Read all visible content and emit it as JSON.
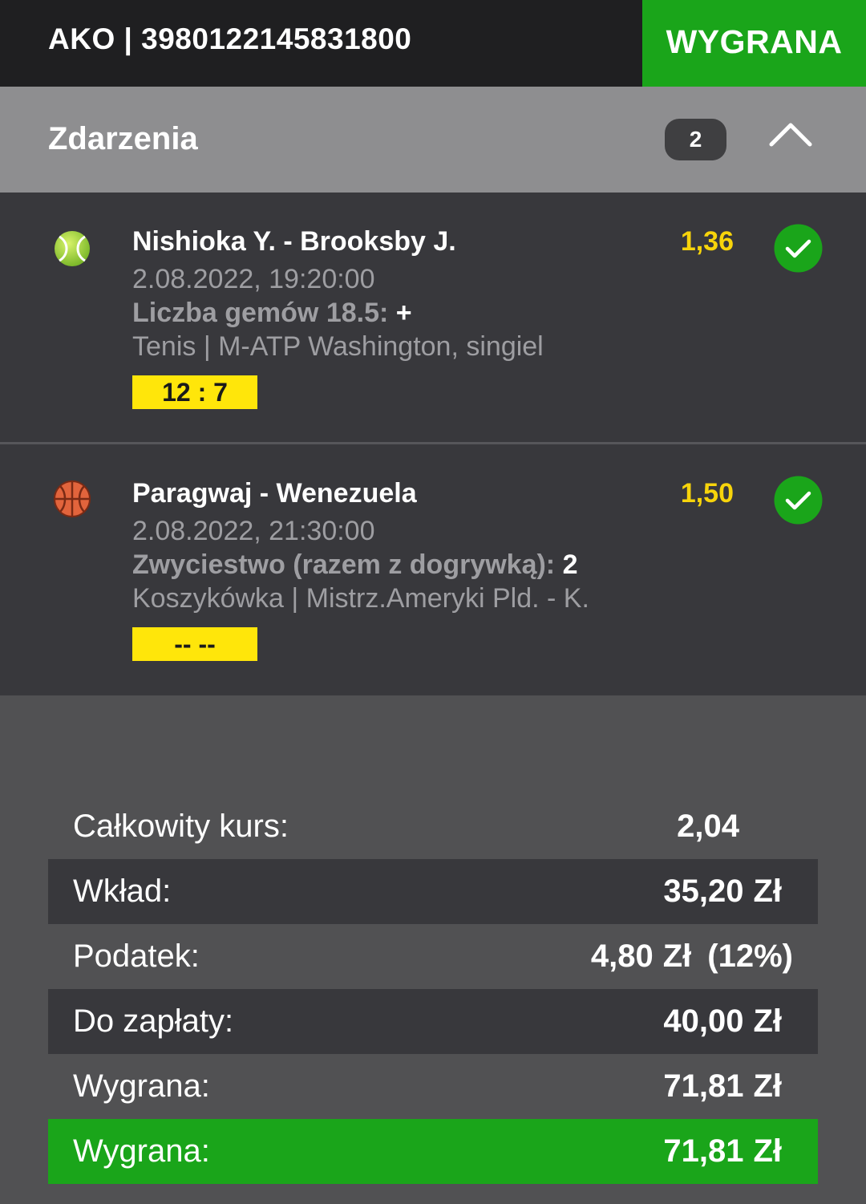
{
  "header": {
    "ticket_id": "AKO | 3980122145831800",
    "result": "WYGRANA"
  },
  "section": {
    "title": "Zdarzenia",
    "count": "2",
    "toggle_icon": "chevron-up-icon"
  },
  "events": [
    {
      "sport_icon": "tennis-ball-icon",
      "name": "Nishioka Y. - Brooksby J.",
      "date": "2.08.2022, 19:20:00",
      "market": "Liczba gemów 18.5:",
      "pick": "+",
      "league": "Tenis | M-ATP Washington, singiel",
      "score": "12 : 7",
      "odds": "1,36",
      "status_icon": "check-circle-icon"
    },
    {
      "sport_icon": "basketball-icon",
      "name": "Paragwaj - Wenezuela",
      "date": "2.08.2022, 21:30:00",
      "market": "Zwyciestwo (razem z dogrywką):",
      "pick": "2",
      "league": "Koszykówka | Mistrz.Ameryki Pld. - K.",
      "score": "-- --",
      "odds": "1,50",
      "status_icon": "check-circle-icon"
    }
  ],
  "summary": {
    "total_odds_label": "Całkowity kurs:",
    "total_odds_value": "2,04",
    "stake_label": "Wkład:",
    "stake_value": "35,20",
    "stake_currency": "Zł",
    "tax_label": "Podatek:",
    "tax_value": "4,80",
    "tax_currency": "Zł",
    "tax_percent": "(12%)",
    "to_pay_label": "Do zapłaty:",
    "to_pay_value": "40,00",
    "to_pay_currency": "Zł",
    "win_label": "Wygrana:",
    "win_value": "71,81",
    "win_currency": "Zł",
    "final_win_label": "Wygrana:",
    "final_win_value": "71,81",
    "final_win_currency": "Zł"
  },
  "colors": {
    "win_green": "#1aa51a",
    "odds_yellow": "#f7d40b",
    "score_yellow": "#ffe60a",
    "header_dark": "#1f1f21",
    "section_gray": "#8e8e90",
    "panel_dark": "#38383c",
    "background": "#515153"
  }
}
